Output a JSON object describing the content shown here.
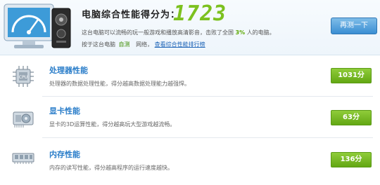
{
  "header": {
    "score_label": "电脑综合性能得分为：",
    "score_value": "1723",
    "description_prefix": "这台电脑可以流畅的玩一般游戏和播放高清影音，击败了全国",
    "beat_percent": "3%",
    "description_suffix": "人的电脑。",
    "detail_prefix": "按于这台电脑",
    "detail_link_self": "自测",
    "detail_middle": "网络，",
    "detail_link_rank": "查看综合性能排行榜",
    "retest_label": "再测一下"
  },
  "rows": [
    {
      "title": "处理器性能",
      "description": "处理器的数据处理性能，得分越高数据处理能力越强悍。",
      "score": "1031分",
      "icon": "cpu-icon"
    },
    {
      "title": "显卡性能",
      "description": "显卡的3D运算性能，得分越高玩大型游戏越流畅。",
      "score": "63分",
      "icon": "graphics-card-icon"
    },
    {
      "title": "内存性能",
      "description": "内存的读写性能，得分越高程序的运行速度越快。",
      "score": "136分",
      "icon": "memory-icon"
    }
  ],
  "colors": {
    "score_green": "#7cc11f",
    "title_blue": "#2a7dc9",
    "badge_green": "#63a713",
    "retest_blue": "#3a8ed3"
  }
}
